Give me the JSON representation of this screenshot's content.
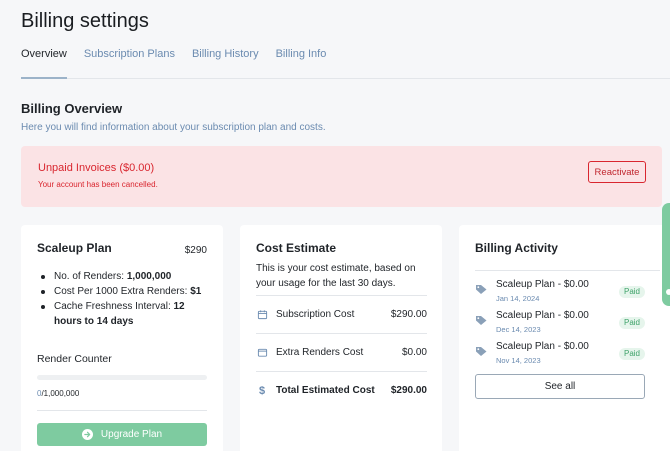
{
  "page": {
    "title": "Billing settings"
  },
  "tabs": [
    {
      "label": "Overview",
      "active": true
    },
    {
      "label": "Subscription Plans",
      "active": false
    },
    {
      "label": "Billing History",
      "active": false
    },
    {
      "label": "Billing Info",
      "active": false
    }
  ],
  "overview": {
    "title": "Billing Overview",
    "subtitle": "Here you will find information about your subscription plan and costs."
  },
  "alert": {
    "title": "Unpaid Invoices  ($0.00)",
    "message": "Your account has been cancelled.",
    "button_label": "Reactivate",
    "color": "#d9262f"
  },
  "plan_card": {
    "title": "Scaleup Plan",
    "price": "$290",
    "features": [
      {
        "label": "No. of Renders:",
        "value": "1,000,000"
      },
      {
        "label": "Cost Per 1000 Extra Renders:",
        "value": "$1"
      },
      {
        "label": "Cache Freshness Interval:",
        "value": "12 hours to 14 days"
      }
    ],
    "render_counter": {
      "title": "Render Counter",
      "current": "0",
      "limit": "/1,000,000",
      "progress_fraction": 0
    },
    "upgrade_label": "Upgrade Plan",
    "upgrade_icon": "arrow-circle-icon",
    "accent": "#7ecba0"
  },
  "cost_card": {
    "title": "Cost Estimate",
    "description": "This is your cost estimate, based on your usage for the last 30 days.",
    "rows": [
      {
        "icon": "calendar-icon",
        "label": "Subscription Cost",
        "value": "$290.00"
      },
      {
        "icon": "wallet-icon",
        "label": "Extra Renders Cost",
        "value": "$0.00"
      },
      {
        "icon": "dollar-icon",
        "label": "Total Estimated Cost",
        "value": "$290.00"
      }
    ]
  },
  "activity_card": {
    "title": "Billing Activity",
    "items": [
      {
        "icon": "tag-icon",
        "name": "Scaleup Plan - $0.00",
        "date": "Jan 14, 2024",
        "status": "Paid"
      },
      {
        "icon": "tag-icon",
        "name": "Scaleup Plan - $0.00",
        "date": "Dec 14, 2023",
        "status": "Paid"
      },
      {
        "icon": "tag-icon",
        "name": "Scaleup Plan - $0.00",
        "date": "Nov 14, 2023",
        "status": "Paid"
      }
    ],
    "see_all_label": "See all"
  }
}
